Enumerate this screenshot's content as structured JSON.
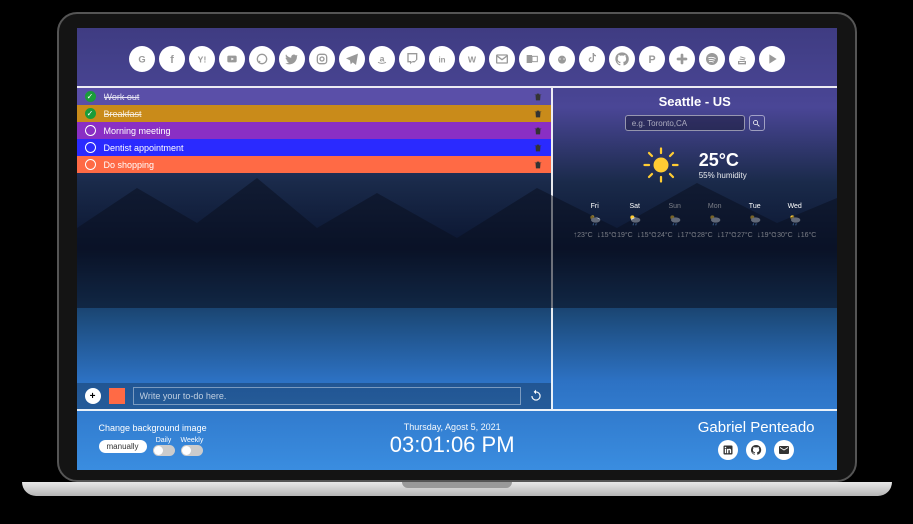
{
  "icons": [
    "google",
    "facebook",
    "yahoo",
    "youtube",
    "whatsapp",
    "twitter",
    "instagram",
    "telegram",
    "amazon",
    "twitch",
    "linkedin",
    "wikipedia",
    "gmail",
    "outlook",
    "reddit",
    "tiktok",
    "github",
    "pinterest",
    "slack",
    "spotify",
    "stackoverflow",
    "play"
  ],
  "todos": [
    {
      "text": "Work out",
      "done": true,
      "color": "#5a4fa8"
    },
    {
      "text": "Breakfast",
      "done": true,
      "color": "#c98b1a"
    },
    {
      "text": "Morning meeting",
      "done": false,
      "color": "#8a2fc4"
    },
    {
      "text": "Dentist appointment",
      "done": false,
      "color": "#2a2aff"
    },
    {
      "text": "Do shopping",
      "done": false,
      "color": "#ff6a45"
    }
  ],
  "todo_input": {
    "placeholder": "Write your to-do here."
  },
  "weather": {
    "city": "Seattle - US",
    "search_placeholder": "e.g. Toronto,CA",
    "temp": "25°C",
    "humidity": "55% humidity",
    "forecast": [
      {
        "day": "Fri",
        "hi": "23°C",
        "lo": "15°C"
      },
      {
        "day": "Sat",
        "hi": "19°C",
        "lo": "15°C"
      },
      {
        "day": "Sun",
        "hi": "24°C",
        "lo": "17°C"
      },
      {
        "day": "Mon",
        "hi": "28°C",
        "lo": "17°C"
      },
      {
        "day": "Tue",
        "hi": "27°C",
        "lo": "19°C"
      },
      {
        "day": "Wed",
        "hi": "30°C",
        "lo": "16°C"
      }
    ]
  },
  "footer": {
    "bg_label": "Change background image",
    "manual": "manually",
    "daily": "Daily",
    "weekly": "Weekly",
    "date": "Thursday, Agost 5, 2021",
    "time": "03:01:06 PM",
    "author": "Gabriel Penteado"
  }
}
